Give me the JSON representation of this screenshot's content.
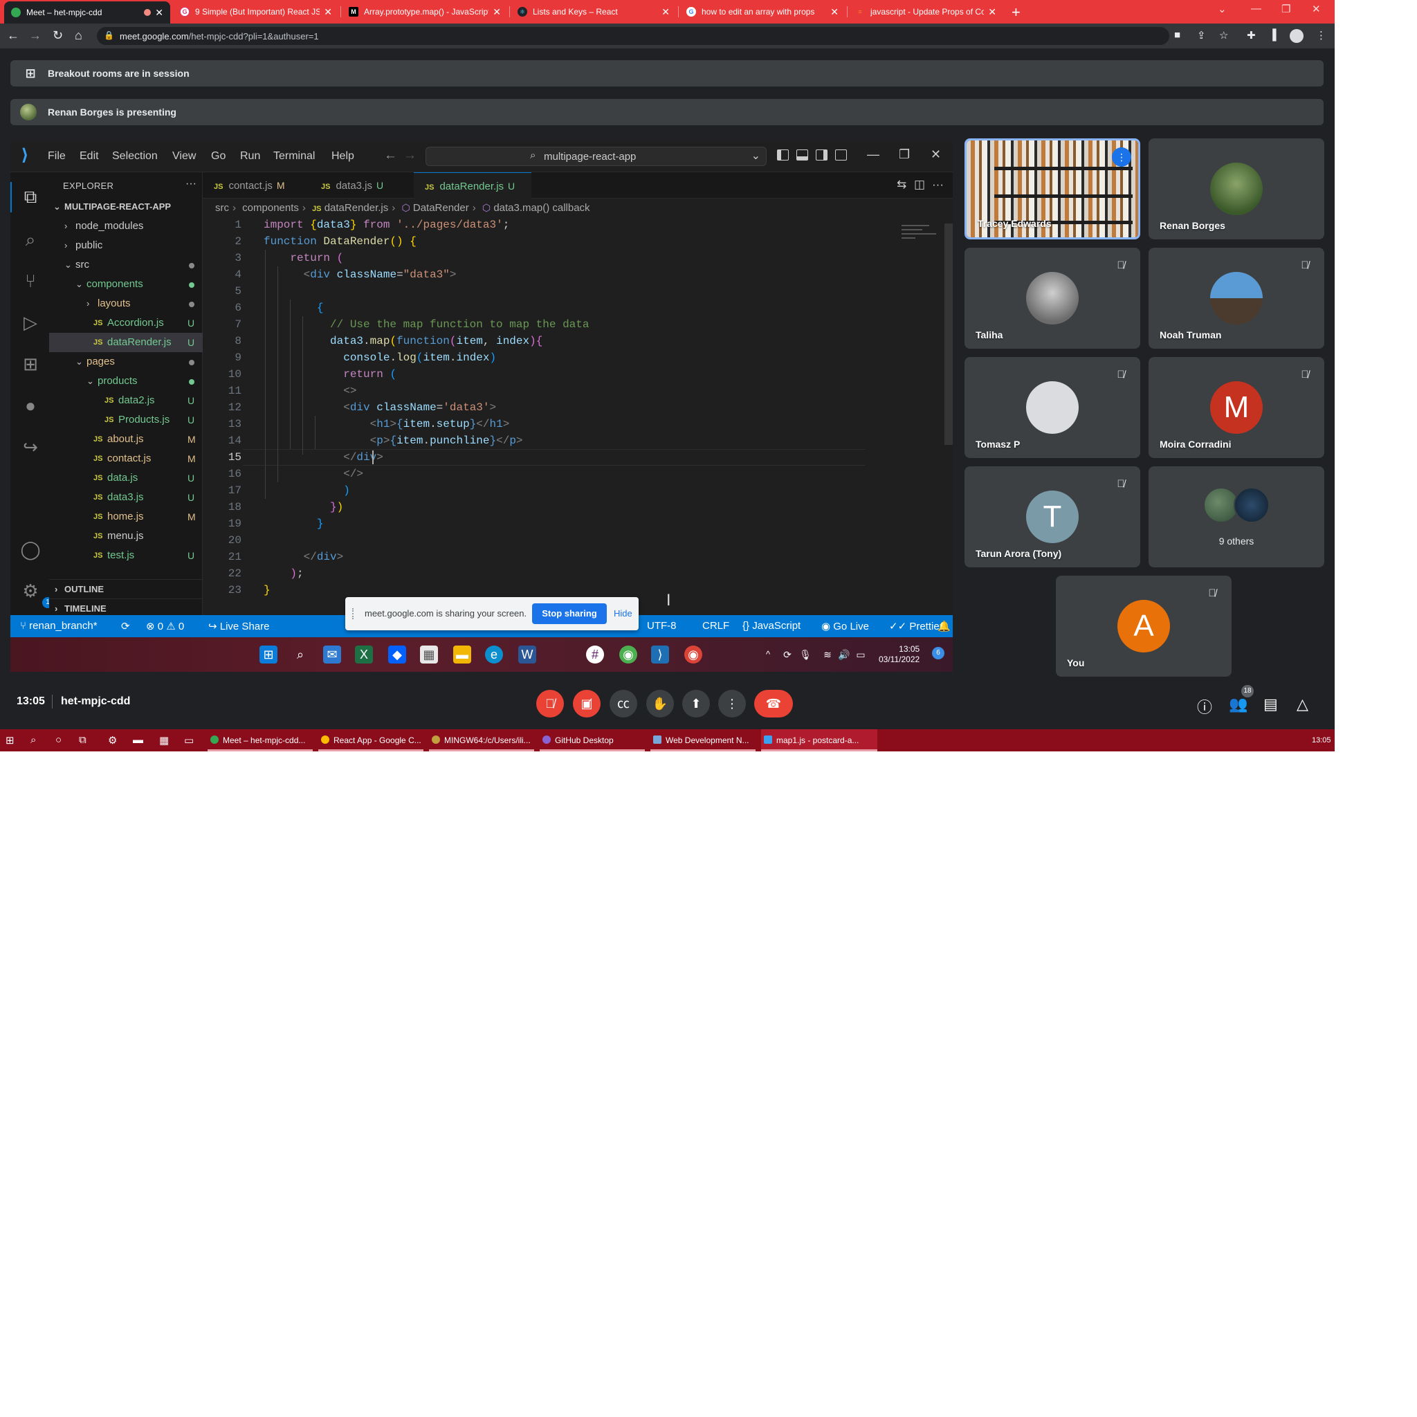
{
  "browser": {
    "tabs": [
      {
        "title": "Meet – het-mpjc-cdd",
        "active": true
      },
      {
        "title": "9 Simple (But Important) React JS"
      },
      {
        "title": "Array.prototype.map() - JavaScript"
      },
      {
        "title": "Lists and Keys – React"
      },
      {
        "title": "how to edit an array with props"
      },
      {
        "title": "javascript - Update Props of Com"
      }
    ],
    "new_tab": "+",
    "url_host": "meet.google.com",
    "url_path": "/het-mpjc-cdd?pli=1&authuser=1"
  },
  "banners": {
    "breakout": "Breakout rooms are in session",
    "presenting": "Renan Borges is presenting"
  },
  "vscode": {
    "menu": [
      "File",
      "Edit",
      "Selection",
      "View",
      "Go",
      "Run",
      "Terminal",
      "Help"
    ],
    "search": "multipage-react-app",
    "explorer_title": "EXPLORER",
    "project": "MULTIPAGE-REACT-APP",
    "tree": [
      {
        "name": "node_modules",
        "type": "folder",
        "indent": 0,
        "open": false
      },
      {
        "name": "public",
        "type": "folder",
        "indent": 0,
        "open": false
      },
      {
        "name": "src",
        "type": "folder",
        "indent": 0,
        "open": true,
        "dot": "#8a8a8a"
      },
      {
        "name": "components",
        "type": "folder",
        "indent": 1,
        "open": true,
        "dot": "#73c991",
        "color": "#73c991"
      },
      {
        "name": "layouts",
        "type": "folder",
        "indent": 2,
        "open": false,
        "dot": "#8a8a8a",
        "color": "#e2c08d"
      },
      {
        "name": "Accordion.js",
        "type": "js",
        "indent": 2,
        "status": "U",
        "color": "#73c991"
      },
      {
        "name": "dataRender.js",
        "type": "js",
        "indent": 2,
        "status": "U",
        "color": "#73c991",
        "selected": true
      },
      {
        "name": "pages",
        "type": "folder",
        "indent": 1,
        "open": true,
        "dot": "#8a8a8a",
        "color": "#e2c08d"
      },
      {
        "name": "products",
        "type": "folder",
        "indent": 2,
        "open": true,
        "dot": "#73c991",
        "color": "#73c991"
      },
      {
        "name": "data2.js",
        "type": "js",
        "indent": 3,
        "status": "U",
        "color": "#73c991"
      },
      {
        "name": "Products.js",
        "type": "js",
        "indent": 3,
        "status": "U",
        "color": "#73c991"
      },
      {
        "name": "about.js",
        "type": "js",
        "indent": 2,
        "status": "M",
        "color": "#e2c08d"
      },
      {
        "name": "contact.js",
        "type": "js",
        "indent": 2,
        "status": "M",
        "color": "#e2c08d"
      },
      {
        "name": "data.js",
        "type": "js",
        "indent": 2,
        "status": "U",
        "color": "#73c991"
      },
      {
        "name": "data3.js",
        "type": "js",
        "indent": 2,
        "status": "U",
        "color": "#73c991"
      },
      {
        "name": "home.js",
        "type": "js",
        "indent": 2,
        "status": "M",
        "color": "#e2c08d"
      },
      {
        "name": "menu.js",
        "type": "js",
        "indent": 2,
        "status": "",
        "color": "#cccccc"
      },
      {
        "name": "test.js",
        "type": "js",
        "indent": 2,
        "status": "U",
        "color": "#73c991"
      }
    ],
    "outline": "OUTLINE",
    "timeline": "TIMELINE",
    "editor_tabs": [
      {
        "name": "contact.js",
        "flag": "M"
      },
      {
        "name": "data3.js",
        "flag": "U"
      },
      {
        "name": "dataRender.js",
        "flag": "U",
        "active": true
      }
    ],
    "breadcrumb": [
      "src",
      "components",
      "dataRender.js",
      "DataRender",
      "data3.map() callback"
    ],
    "current_line": 15,
    "status": {
      "branch": "renan_branch*",
      "problems": "⊗ 0 ⚠ 0",
      "live_share": "Live Share",
      "encoding": "UTF-8",
      "eol": "CRLF",
      "language": "JavaScript",
      "go_live": "Go Live",
      "prettier": "Prettier"
    },
    "activity_badge": "1"
  },
  "share_bar": {
    "message": "meet.google.com is sharing your screen.",
    "stop": "Stop sharing",
    "hide": "Hide"
  },
  "inner_taskbar": {
    "time": "13:05",
    "date": "03/11/2022",
    "notifications": "6"
  },
  "participants": [
    {
      "name": "Tracey Edwards",
      "speaking": true
    },
    {
      "name": "Renan Borges"
    },
    {
      "name": "Taliha",
      "muted": true
    },
    {
      "name": "Noah Truman",
      "muted": true
    },
    {
      "name": "Tomasz P",
      "muted": true
    },
    {
      "name": "Moira Corradini",
      "muted": true,
      "initial": "M",
      "color": "#c5321f"
    },
    {
      "name": "Tarun Arora (Tony)",
      "muted": true,
      "initial": "T",
      "color": "#7a9aa8"
    },
    {
      "others": "9 others"
    },
    {
      "name": "You",
      "muted": true,
      "initial": "A",
      "color": "#e8710a"
    }
  ],
  "meeting": {
    "time": "13:05",
    "code": "het-mpjc-cdd",
    "people_count": "18"
  },
  "os_taskbar": {
    "apps": [
      {
        "label": "Meet – het-mpjc-cdd...",
        "color": "#34a853"
      },
      {
        "label": "React App - Google C...",
        "color": "#fbbc04"
      },
      {
        "label": "MINGW64:/c/Users/ili...",
        "color": "#c2a040"
      },
      {
        "label": "GitHub Desktop",
        "color": "#8a63d2"
      },
      {
        "label": "Web Development N...",
        "color": "#7aa7d9"
      },
      {
        "label": "map1.js - postcard-a...",
        "color": "#3ba0f0"
      }
    ],
    "time": "13:05"
  }
}
